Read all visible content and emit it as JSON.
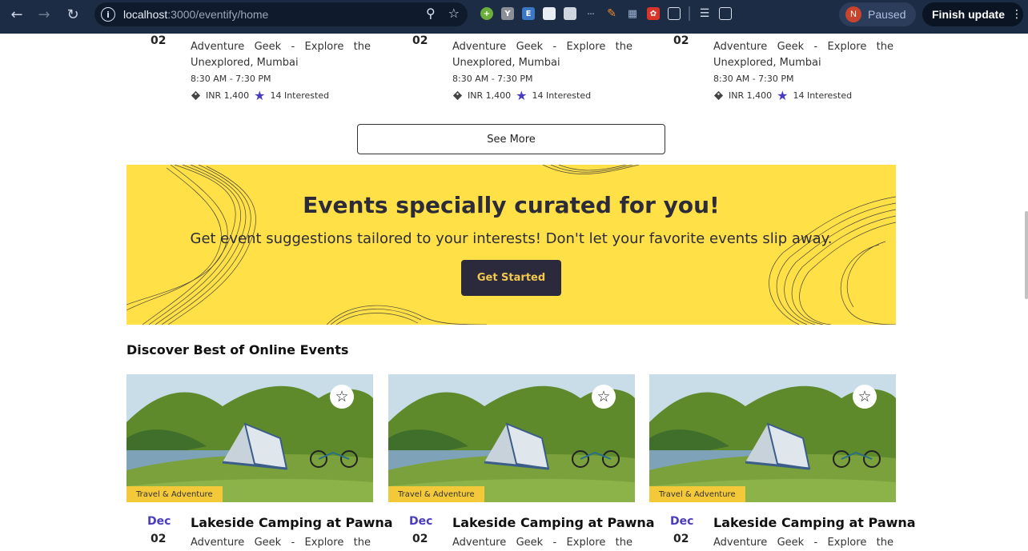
{
  "browser": {
    "url_host": "localhost",
    "url_path": ":3000/eventify/home",
    "profile_initial": "N",
    "profile_status": "Paused",
    "finish_update_label": "Finish update",
    "extensions": [
      "plus-circle-icon",
      "y-icon",
      "e-icon",
      "box-icon",
      "hand-icon",
      "dots-icon",
      "pen-icon",
      "chart-icon",
      "flower-icon",
      "puzzle-icon",
      "media-icon",
      "sidepanel-icon"
    ]
  },
  "top_events": [
    {
      "day": "02",
      "description": "Adventure Geek - Explore the Unexplored, Mumbai",
      "time": "8:30 AM - 7:30 PM",
      "price": "INR 1,400",
      "interested": "14 Interested"
    },
    {
      "day": "02",
      "description": "Adventure Geek - Explore the Unexplored, Mumbai",
      "time": "8:30 AM - 7:30 PM",
      "price": "INR 1,400",
      "interested": "14 Interested"
    },
    {
      "day": "02",
      "description": "Adventure Geek - Explore the Unexplored, Mumbai",
      "time": "8:30 AM - 7:30 PM",
      "price": "INR 1,400",
      "interested": "14 Interested"
    }
  ],
  "see_more_label": "See More",
  "banner": {
    "title": "Events specially curated for you!",
    "subtitle": "Get event suggestions tailored to your interests! Don't let your favorite events slip away.",
    "cta_label": "Get Started"
  },
  "online_section_title": "Discover Best of Online Events",
  "online_events": [
    {
      "category": "Travel & Adventure",
      "month": "Dec",
      "day": "02",
      "title": "Lakeside Camping at Pawna",
      "description": "Adventure Geek - Explore the"
    },
    {
      "category": "Travel & Adventure",
      "month": "Dec",
      "day": "02",
      "title": "Lakeside Camping at Pawna",
      "description": "Adventure Geek - Explore the"
    },
    {
      "category": "Travel & Adventure",
      "month": "Dec",
      "day": "02",
      "title": "Lakeside Camping at Pawna",
      "description": "Adventure Geek - Explore the"
    }
  ],
  "colors": {
    "banner_bg": "#ffe047",
    "accent": "#4a3cc0",
    "category_bg": "#f3c93a",
    "cta_bg": "#2b2a3d"
  }
}
